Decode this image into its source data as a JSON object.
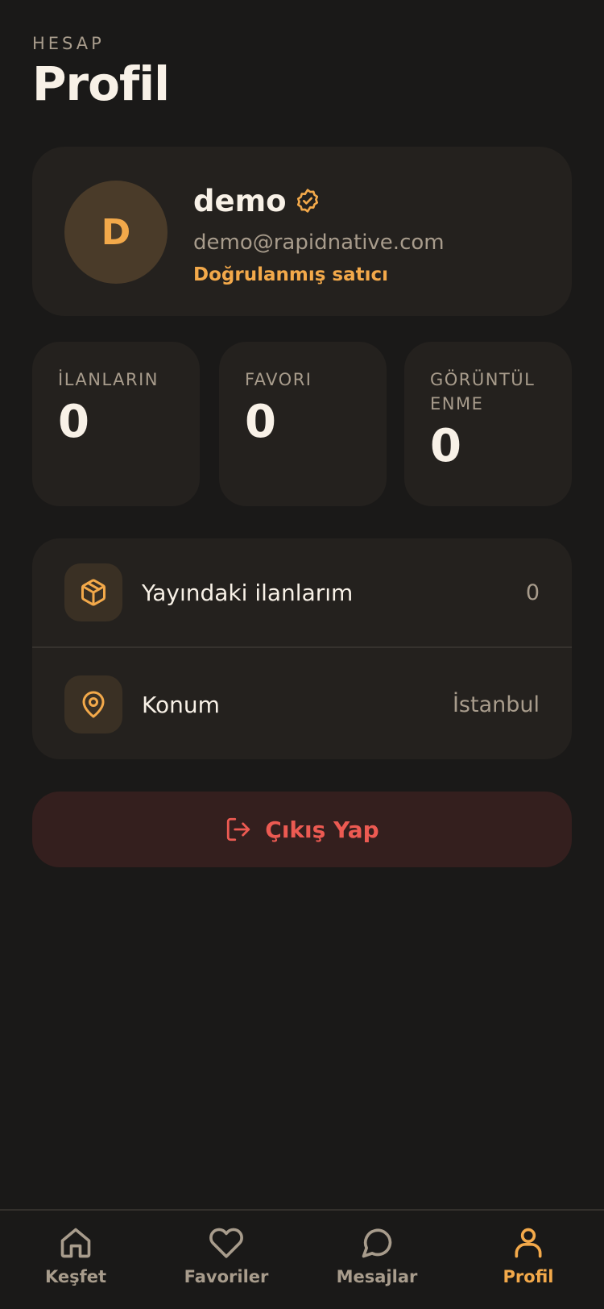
{
  "header": {
    "eyebrow": "HESAP",
    "title": "Profil"
  },
  "profile": {
    "avatar_initial": "D",
    "name": "demo",
    "email": "demo@rapidnative.com",
    "seller_status": "Doğrulanmış satıcı",
    "verified_icon": "verified-badge-icon"
  },
  "stats": [
    {
      "label": "İLANLARIN",
      "value": "0"
    },
    {
      "label": "FAVORI",
      "value": "0"
    },
    {
      "label": "GÖRÜNTÜLENME",
      "value": "0"
    }
  ],
  "menu": {
    "items": [
      {
        "icon": "package-icon",
        "label": "Yayındaki ilanlarım",
        "value": "0"
      },
      {
        "icon": "location-pin-icon",
        "label": "Konum",
        "value": "İstanbul"
      }
    ]
  },
  "logout": {
    "icon": "logout-icon",
    "label": "Çıkış Yap"
  },
  "tabbar": {
    "active": "Profil",
    "items": [
      {
        "icon": "home-icon",
        "label": "Keşfet"
      },
      {
        "icon": "heart-icon",
        "label": "Favoriler"
      },
      {
        "icon": "chat-bubble-icon",
        "label": "Mesajlar"
      },
      {
        "icon": "user-icon",
        "label": "Profil"
      }
    ]
  },
  "colors": {
    "background": "#1a1918",
    "card": "#24211e",
    "accent": "#f3a94a",
    "danger": "#ec5a52",
    "muted_text": "#a89c8c"
  }
}
